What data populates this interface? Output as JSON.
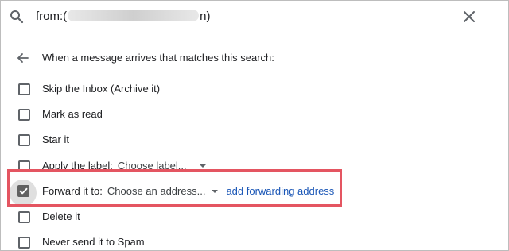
{
  "search": {
    "query_prefix": "from:(",
    "query_suffix": "n)"
  },
  "header": {
    "back_text": "When a message arrives that matches this search:"
  },
  "options": {
    "skip_inbox": "Skip the Inbox (Archive it)",
    "mark_read": "Mark as read",
    "star": "Star it",
    "apply_label": "Apply the label:",
    "label_select": "Choose label...",
    "forward": "Forward it to:",
    "forward_select": "Choose an address...",
    "add_forwarding": "add forwarding address",
    "delete": "Delete it",
    "never_spam": "Never send it to Spam"
  },
  "state": {
    "forward_checked": true
  },
  "colors": {
    "highlight": "#e45561",
    "link": "#1a56b6",
    "checkbox": "#616161"
  },
  "icons": {
    "search": "search-icon",
    "close": "close-icon",
    "back": "arrow-back-icon",
    "check": "checkmark-icon"
  }
}
